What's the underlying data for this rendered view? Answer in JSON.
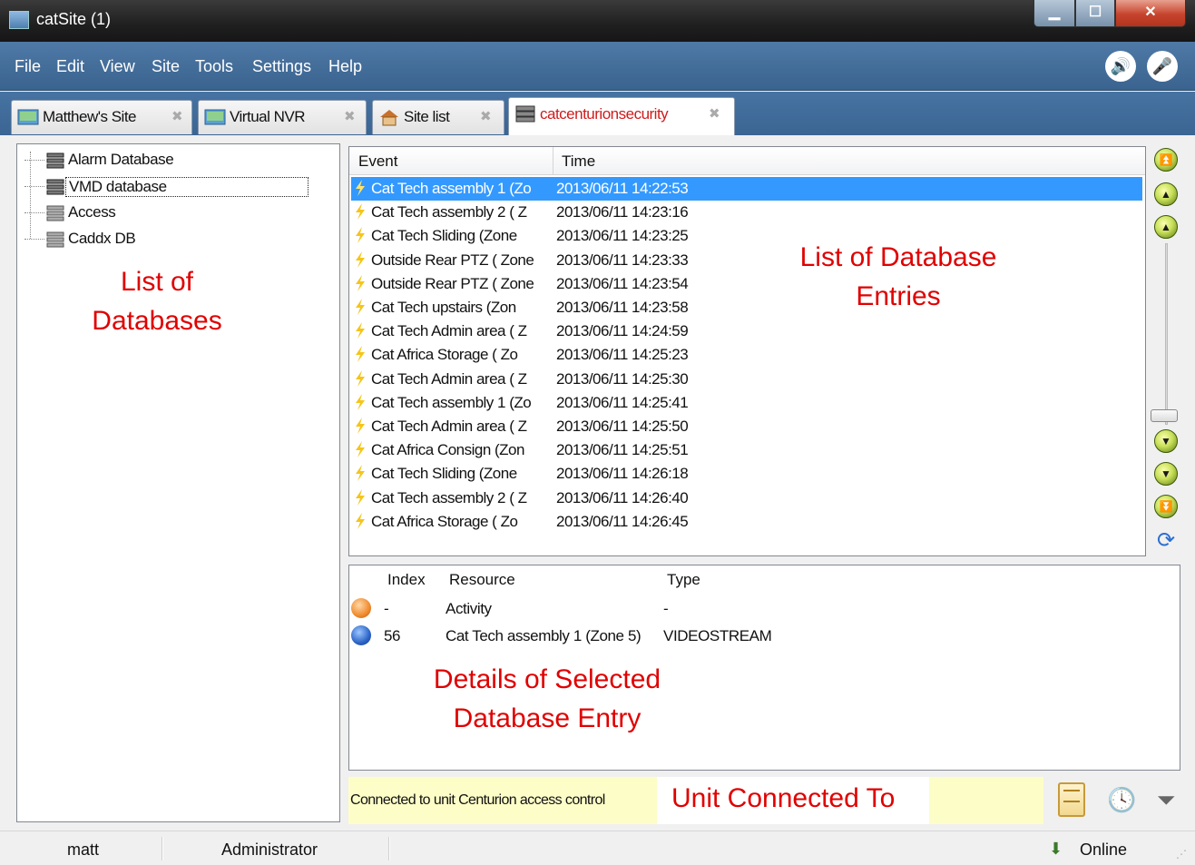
{
  "window": {
    "title": "catSite (1)"
  },
  "menu": [
    "File",
    "Edit",
    "View",
    "Site",
    "Tools",
    "Settings",
    "Help"
  ],
  "tabs": [
    {
      "label": "Matthew's Site",
      "active": false
    },
    {
      "label": "Virtual NVR",
      "active": false
    },
    {
      "label": "Site list",
      "active": false
    },
    {
      "label": "catcenturionsecurity",
      "active": true
    }
  ],
  "databases": {
    "items": [
      "Alarm Database",
      "VMD database",
      "Access",
      "Caddx DB"
    ],
    "selected": "VMD database"
  },
  "events": {
    "columns": {
      "event": "Event",
      "time": "Time"
    },
    "rows": [
      {
        "event": "Cat Tech assembly 1 (Zo",
        "time": "2013/06/11 14:22:53",
        "selected": true
      },
      {
        "event": "Cat Tech assembly 2 ( Z",
        "time": "2013/06/11 14:23:16"
      },
      {
        "event": "Cat Tech Sliding (Zone",
        "time": "2013/06/11 14:23:25"
      },
      {
        "event": "Outside Rear PTZ ( Zone",
        "time": "2013/06/11 14:23:33"
      },
      {
        "event": "Outside Rear PTZ ( Zone",
        "time": "2013/06/11 14:23:54"
      },
      {
        "event": "Cat Tech upstairs  (Zon",
        "time": "2013/06/11 14:23:58"
      },
      {
        "event": "Cat Tech Admin area ( Z",
        "time": "2013/06/11 14:24:59"
      },
      {
        "event": "Cat Africa Storage ( Zo",
        "time": "2013/06/11 14:25:23"
      },
      {
        "event": "Cat Tech Admin area ( Z",
        "time": "2013/06/11 14:25:30"
      },
      {
        "event": "Cat Tech assembly 1 (Zo",
        "time": "2013/06/11 14:25:41"
      },
      {
        "event": "Cat Tech Admin area ( Z",
        "time": "2013/06/11 14:25:50"
      },
      {
        "event": "Cat Africa Consign (Zon",
        "time": "2013/06/11 14:25:51"
      },
      {
        "event": "Cat Tech Sliding (Zone",
        "time": "2013/06/11 14:26:18"
      },
      {
        "event": "Cat Tech assembly 2 ( Z",
        "time": "2013/06/11 14:26:40"
      },
      {
        "event": "Cat Africa Storage ( Zo",
        "time": "2013/06/11 14:26:45"
      }
    ]
  },
  "details": {
    "columns": {
      "index": "Index",
      "resource": "Resource",
      "type": "Type"
    },
    "rows": [
      {
        "icon": "activity-icon",
        "index": "-",
        "resource": "Activity",
        "type": "-"
      },
      {
        "icon": "videostream-icon",
        "index": "56",
        "resource": "Cat Tech assembly 1 (Zone 5)",
        "type": "VIDEOSTREAM"
      }
    ]
  },
  "connection": {
    "text": "Connected to unit Centurion access control"
  },
  "annotations": {
    "databases": [
      "List of",
      "Databases"
    ],
    "entries": [
      "List of Database",
      "Entries"
    ],
    "details": [
      "Details of Selected",
      "Database Entry"
    ],
    "unit": "Unit Connected To"
  },
  "status": {
    "user": "matt",
    "role": "Administrator",
    "state": "Online"
  },
  "colors": {
    "menu_bar": "#3f6a97",
    "selection": "#3399ff",
    "annotation": "#e00000",
    "connection_bg": "#fdfdc8"
  }
}
